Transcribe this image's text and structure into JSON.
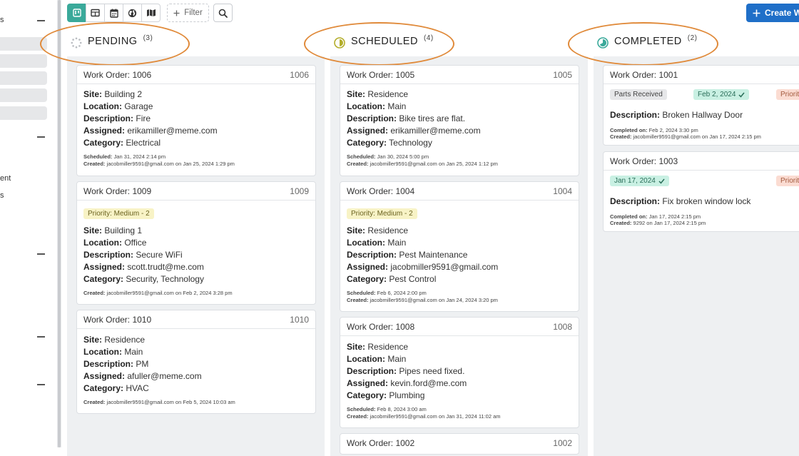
{
  "sidebar": {
    "labels": [
      "s",
      "ent",
      "s"
    ]
  },
  "toolbar": {
    "views": [
      "board-view-icon",
      "table-view-icon",
      "calendar-view-icon",
      "globe-view-icon",
      "map-view-icon"
    ],
    "filter_label": "Filter",
    "create_label": "Create W"
  },
  "columns": [
    {
      "title": "PENDING",
      "count": "(3)"
    },
    {
      "title": "SCHEDULED",
      "count": "(4)"
    },
    {
      "title": "COMPLETED",
      "count": "(2)"
    }
  ],
  "labels": {
    "site": "Site:",
    "location": "Location:",
    "description": "Description:",
    "assigned": "Assigned:",
    "category": "Category:",
    "scheduled": "Scheduled:",
    "created": "Created:",
    "completed_on": "Completed on:"
  },
  "pending": [
    {
      "title": "Work Order: 1006",
      "num": "1006",
      "site": "Building 2",
      "location": "Garage",
      "description": "Fire",
      "assigned": "erikamiller@meme.com",
      "category": "Electrical",
      "scheduled": "Jan 31, 2024 2:14 pm",
      "created": "jacobmiller9591@gmail.com on Jan 25, 2024 1:29 pm"
    },
    {
      "title": "Work Order: 1009",
      "num": "1009",
      "priority": "Priority: Medium - 2",
      "site": "Building 1",
      "location": "Office",
      "description": "Secure WiFi",
      "assigned": "scott.trudt@me.com",
      "category": "Security, Technology",
      "created": "jacobmiller9591@gmail.com on Feb 2, 2024 3:28 pm"
    },
    {
      "title": "Work Order: 1010",
      "num": "1010",
      "site": "Residence",
      "location": "Main",
      "description": "PM",
      "assigned": "afuller@meme.com",
      "category": "HVAC",
      "created": "jacobmiller9591@gmail.com on Feb 5, 2024 10:03 am"
    }
  ],
  "scheduled": [
    {
      "title": "Work Order: 1005",
      "num": "1005",
      "site": "Residence",
      "location": "Main",
      "description": "Bike tires are flat.",
      "assigned": "erikamiller@meme.com",
      "category": "Technology",
      "scheduled": "Jan 30, 2024 5:00 pm",
      "created": "jacobmiller9591@gmail.com on Jan 25, 2024 1:12 pm"
    },
    {
      "title": "Work Order: 1004",
      "num": "1004",
      "priority": "Priority: Medium - 2",
      "site": "Residence",
      "location": "Main",
      "description": "Pest Maintenance",
      "assigned": "jacobmiller9591@gmail.com",
      "category": "Pest Control",
      "scheduled": "Feb 6, 2024 2:00 pm",
      "created": "jacobmiller9591@gmail.com on Jan 24, 2024 3:20 pm"
    },
    {
      "title": "Work Order: 1008",
      "num": "1008",
      "site": "Residence",
      "location": "Main",
      "description": "Pipes need fixed.",
      "assigned": "kevin.ford@me.com",
      "category": "Plumbing",
      "scheduled": "Feb 8, 2024 3:00 am",
      "created": "jacobmiller9591@gmail.com on Jan 31, 2024 11:02 am"
    },
    {
      "title": "Work Order: 1002",
      "num": "1002"
    }
  ],
  "completed": [
    {
      "title": "Work Order: 1001",
      "parts": "Parts Received",
      "date": "Feb 2, 2024",
      "priority": "Priorit",
      "description": "Broken Hallway Door",
      "completed_on": "Feb 2, 2024 3:30 pm",
      "created": "jacobmiller9591@gmail.com on Jan 17, 2024 2:15 pm"
    },
    {
      "title": "Work Order: 1003",
      "date": "Jan 17, 2024",
      "priority": "Priorit",
      "description": "Fix broken window lock",
      "completed_on": "Jan 17, 2024 2:15 pm",
      "created": "9292 on Jan 17, 2024 2:15 pm"
    }
  ],
  "colors": {
    "accent": "#3aa99a",
    "create": "#1f6fc8",
    "highlight": "#e08a3a"
  }
}
